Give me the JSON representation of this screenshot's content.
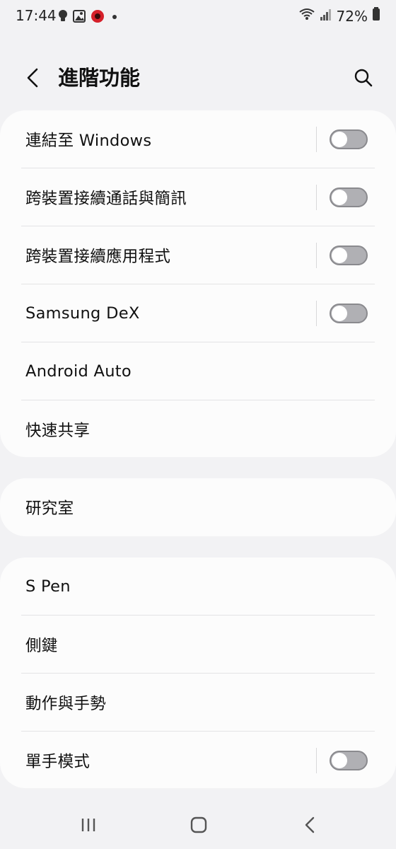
{
  "status_bar": {
    "time": "17:44",
    "battery": "72%",
    "icons_left": [
      "bulb-icon",
      "image-icon",
      "antutu-app-icon",
      "dot-icon"
    ],
    "icons_right": [
      "wifi-icon",
      "signal-icon",
      "battery-icon"
    ]
  },
  "header": {
    "title": "進階功能",
    "back_icon": "chevron-left-icon",
    "search_icon": "search-icon"
  },
  "groups": [
    {
      "items": [
        {
          "label": "連結至 Windows",
          "toggle": false
        },
        {
          "label": "跨裝置接續通話與簡訊",
          "toggle": false
        },
        {
          "label": "跨裝置接續應用程式",
          "toggle": false
        },
        {
          "label": "Samsung DeX",
          "toggle": false
        },
        {
          "label": "Android Auto"
        },
        {
          "label": "快速共享"
        }
      ]
    },
    {
      "items": [
        {
          "label": "研究室"
        }
      ]
    },
    {
      "items": [
        {
          "label": "S Pen"
        },
        {
          "label": "側鍵"
        },
        {
          "label": "動作與手勢"
        },
        {
          "label": "單手模式",
          "toggle": false
        }
      ]
    }
  ],
  "nav_bar": {
    "recent_icon": "recent-apps-icon",
    "home_icon": "home-icon",
    "back_icon": "back-icon"
  },
  "colors": {
    "background": "#f2f2f4",
    "card": "#fcfcfc",
    "toggle_off_track": "#b0b0b4"
  }
}
